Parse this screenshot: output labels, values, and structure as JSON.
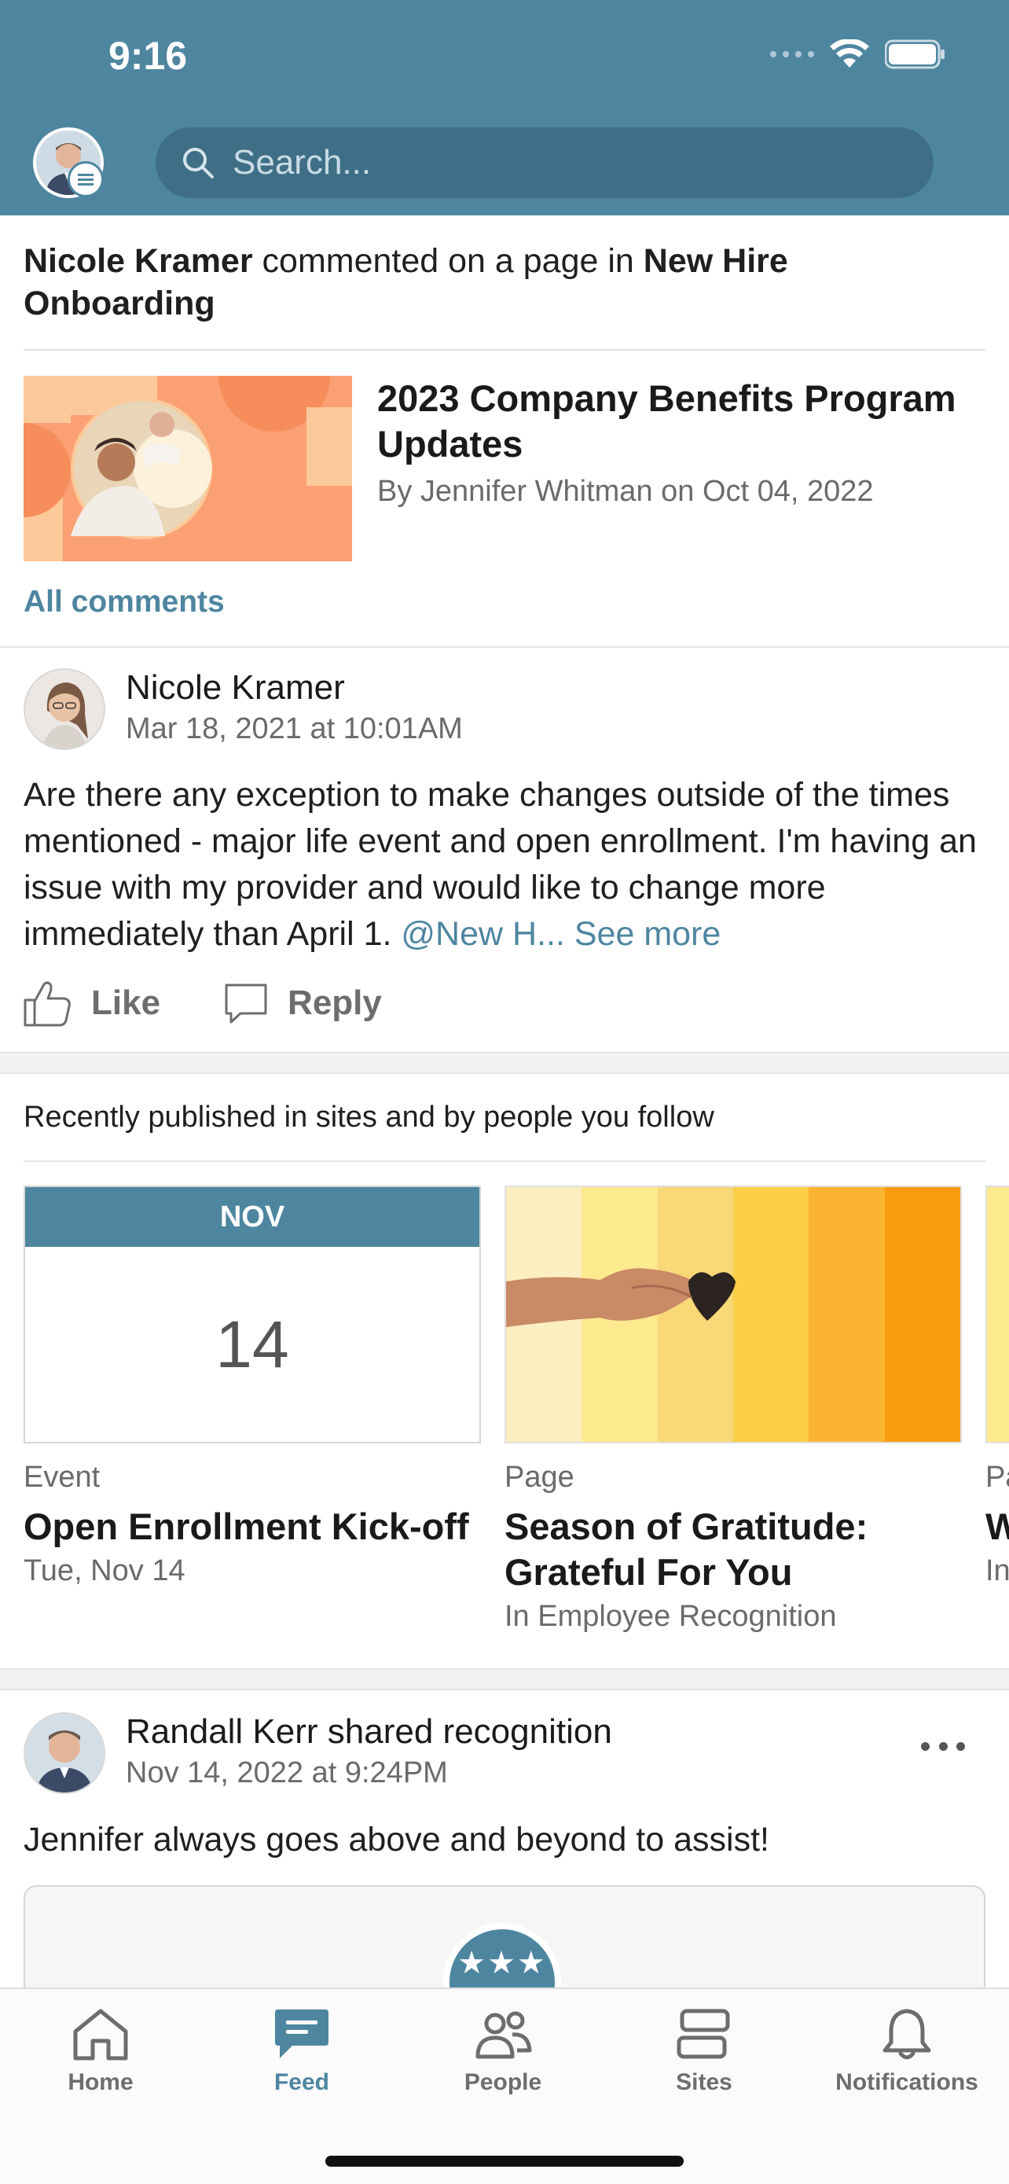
{
  "status_bar": {
    "time": "9:16"
  },
  "header": {
    "search_placeholder": "Search..."
  },
  "activity": {
    "actor": "Nicole Kramer",
    "action": " commented on a page in ",
    "target": "New Hire Onboarding",
    "article": {
      "title": "2023 Company Benefits Program Updates",
      "meta": "By Jennifer Whitman on Oct 04, 2022"
    },
    "all_comments_label": "All comments"
  },
  "comment": {
    "author": "Nicole Kramer",
    "timestamp": "Mar 18, 2021 at 10:01AM",
    "body": "Are there any exception to make changes outside of the times mentioned - major life event and open enrollment. I'm having an issue with my provider and would like to change more immediately than April 1. ",
    "mention": "@New H...",
    "see_more": "See more",
    "like_label": "Like",
    "reply_label": "Reply"
  },
  "recent": {
    "heading": "Recently published in sites and by people you follow",
    "tiles": [
      {
        "month": "NOV",
        "day": "14",
        "type": "Event",
        "title": "Open Enrollment Kick-off",
        "sub": "Tue, Nov 14"
      },
      {
        "type": "Page",
        "title": "Season of Gratitude: Grateful For You",
        "sub": "In Employee Recognition"
      },
      {
        "type": "Pa",
        "title": "W",
        "sub": "In"
      }
    ]
  },
  "recognition": {
    "author": "Randall Kerr",
    "action": " shared recognition",
    "timestamp": "Nov 14, 2022 at 9:24PM",
    "body": "Jennifer always goes above and beyond to assist!",
    "badge_stars": "★★★"
  },
  "tabbar": {
    "tabs": [
      {
        "label": "Home",
        "icon": "home-icon"
      },
      {
        "label": "Feed",
        "icon": "feed-icon"
      },
      {
        "label": "People",
        "icon": "people-icon"
      },
      {
        "label": "Sites",
        "icon": "sites-icon"
      },
      {
        "label": "Notifications",
        "icon": "bell-icon"
      }
    ],
    "active_index": 1
  },
  "colors": {
    "brand": "#4e86a0",
    "article_thumb": "#fb9b6c",
    "gratitude_stripes": [
      "#fbeec0",
      "#fde98e",
      "#f9d878",
      "#fbcf47",
      "#fbb432",
      "#fa9c10"
    ]
  }
}
